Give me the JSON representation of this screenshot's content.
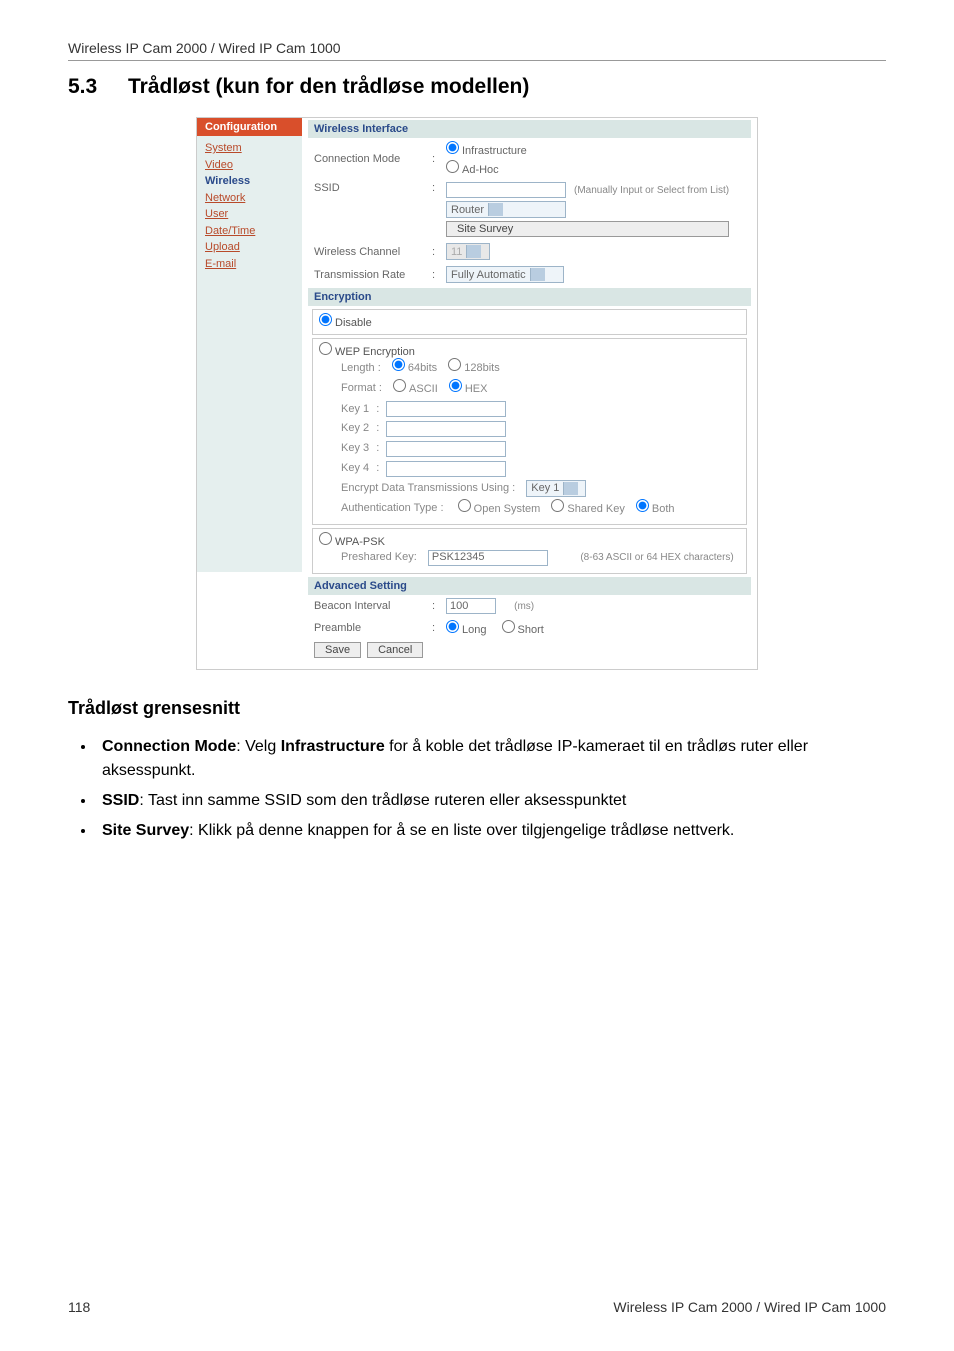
{
  "header": {
    "product_line": "Wireless IP Cam 2000 / Wired IP Cam 1000"
  },
  "section": {
    "number": "5.3",
    "title": "Trådløst (kun for den trådløse modellen)"
  },
  "screenshot": {
    "sidebar": {
      "tab": "Configuration",
      "items": [
        "System",
        "Video",
        "Wireless",
        "Network",
        "User",
        "Date/Time",
        "Upload",
        "E-mail"
      ],
      "active_index": 2
    },
    "wireless_interface": {
      "header": "Wireless Interface",
      "connection_mode": {
        "label": "Connection Mode",
        "opt1": "Infrastructure",
        "opt2": "Ad-Hoc"
      },
      "ssid": {
        "label": "SSID",
        "note": "(Manually Input or Select from List)",
        "dropdown": "Router",
        "button": "Site Survey"
      },
      "wireless_channel": {
        "label": "Wireless Channel",
        "value": "11"
      },
      "transmission_rate": {
        "label": "Transmission Rate",
        "value": "Fully Automatic"
      }
    },
    "encryption": {
      "header": "Encryption",
      "disable": "Disable",
      "wep": {
        "label": "WEP Encryption",
        "length_label": "Length :",
        "length_opt1": "64bits",
        "length_opt2": "128bits",
        "format_label": "Format :",
        "format_opt1": "ASCII",
        "format_opt2": "HEX",
        "key1": "Key 1",
        "key2": "Key 2",
        "key3": "Key 3",
        "key4": "Key 4",
        "encrypt_using_label": "Encrypt Data Transmissions Using :",
        "encrypt_using_value": "Key 1",
        "auth_label": "Authentication Type :",
        "auth_opt1": "Open System",
        "auth_opt2": "Shared Key",
        "auth_opt3": "Both"
      },
      "wpa": {
        "label": "WPA-PSK",
        "preshared_label": "Preshared Key:",
        "preshared_value": "PSK12345",
        "note": "(8-63 ASCII or 64 HEX characters)"
      }
    },
    "advanced": {
      "header": "Advanced Setting",
      "beacon_label": "Beacon Interval",
      "beacon_value": "100",
      "beacon_unit": "(ms)",
      "preamble_label": "Preamble",
      "preamble_opt1": "Long",
      "preamble_opt2": "Short"
    },
    "buttons": {
      "save": "Save",
      "cancel": "Cancel"
    }
  },
  "subsection": {
    "title": "Trådløst grensesnitt"
  },
  "bullets": [
    {
      "strong1": "Connection Mode",
      "midtext": ": Velg ",
      "strong2": "Infrastructure",
      "rest": " for å koble det trådløse IP-kameraet til en trådløs ruter eller aksesspunkt."
    },
    {
      "strong1": "SSID",
      "rest": ": Tast inn samme SSID som den trådløse ruteren eller aksesspunktet"
    },
    {
      "strong1": "Site Survey",
      "rest": ": Klikk på denne knappen for å se en liste over tilgjengelige trådløse nettverk."
    }
  ],
  "footer": {
    "page": "118",
    "product": "Wireless IP Cam 2000 / Wired IP Cam 1000"
  }
}
